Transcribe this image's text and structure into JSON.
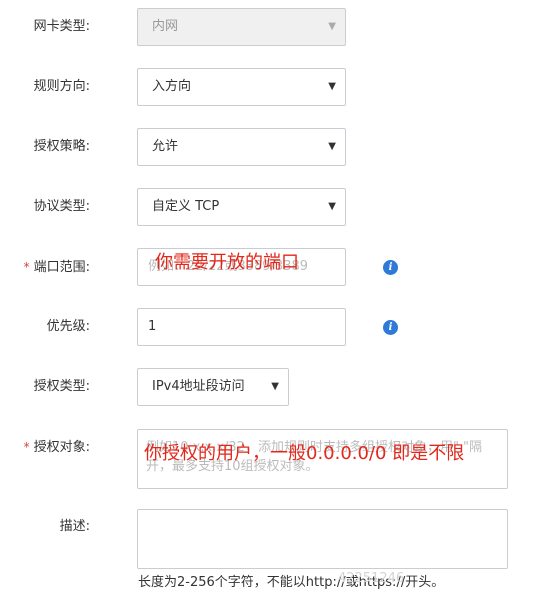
{
  "form": {
    "nic_type": {
      "label": "网卡类型:",
      "value": "内网"
    },
    "direction": {
      "label": "规则方向:",
      "value": "入方向"
    },
    "policy": {
      "label": "授权策略:",
      "value": "允许"
    },
    "protocol": {
      "label": "协议类型:",
      "value": "自定义 TCP"
    },
    "port_range": {
      "required_mark": "*",
      "label": "端口范围:",
      "placeholder": "例如：22/22或3389/3389"
    },
    "priority": {
      "label": "优先级:",
      "value": "1"
    },
    "auth_type": {
      "label": "授权类型:",
      "value": "IPv4地址段访问"
    },
    "auth_object": {
      "required_mark": "*",
      "label": "授权对象:",
      "placeholder": "例如10.x.x.x/32，添加规则时支持多组授权对象，用\",\"隔开，最多支持10组授权对象。"
    },
    "description": {
      "label": "描述:",
      "help": "长度为2-256个字符，不能以http://或https://开头。"
    }
  },
  "annotations": {
    "port_note": "你需要开放的端口",
    "object_note": "你授权的用户，一般0.0.0.0/0 即是不限"
  },
  "watermark": "42251246",
  "icons": {
    "info": "info-icon",
    "dropdown": "caret-down-icon"
  },
  "colors": {
    "annotation": "#e3271b",
    "info": "#2f7ad9",
    "required": "#e4393c"
  }
}
